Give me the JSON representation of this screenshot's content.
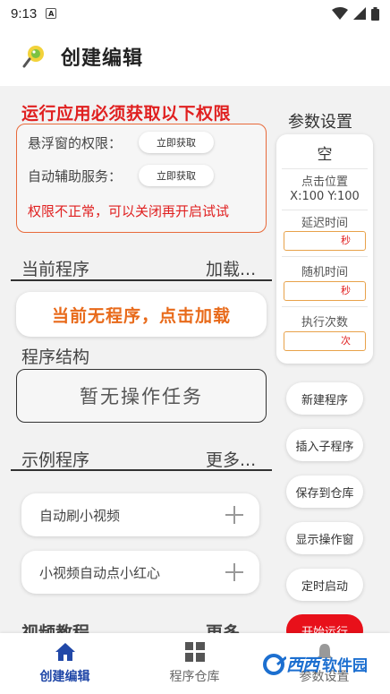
{
  "status_bar": {
    "time": "9:13",
    "notification_letter": "A"
  },
  "app_bar": {
    "title": "创建编辑"
  },
  "permissions": {
    "heading": "运行应用必须获取以下权限",
    "floating_label": "悬浮窗的权限：",
    "floating_button": "立即获取",
    "accessibility_label": "自动辅助服务：",
    "accessibility_button": "立即获取",
    "warning": "权限不正常，可以关闭再开启试试"
  },
  "current_program": {
    "title": "当前程序",
    "action": "加载...",
    "load_button": "当前无程序，点击加载"
  },
  "program_structure": {
    "title": "程序结构",
    "empty": "暂无操作任务"
  },
  "examples": {
    "title": "示例程序",
    "more": "更多...",
    "items": [
      {
        "label": "自动刷小视频"
      },
      {
        "label": "小视频自动点小红心"
      }
    ]
  },
  "tutorials": {
    "title": "视频教程",
    "more": "更多"
  },
  "params": {
    "title": "参数设置",
    "value": "空",
    "click_position_label": "点击位置",
    "click_position_value": "X:100  Y:100",
    "delay_label": "延迟时间",
    "delay_unit": "秒",
    "random_label": "随机时间",
    "random_unit": "秒",
    "count_label": "执行次数",
    "count_unit": "次"
  },
  "side_actions": {
    "new_program": "新建程序",
    "insert_subprogram": "插入子程序",
    "save_to_repo": "保存到仓库",
    "show_window": "显示操作窗",
    "timed_start": "定时启动",
    "start_run": "开始运行"
  },
  "bottom_nav": {
    "items": [
      {
        "label": "创建编辑",
        "active": true
      },
      {
        "label": "程序仓库",
        "active": false
      },
      {
        "label": "参数设置",
        "active": false
      }
    ]
  },
  "watermark": {
    "brand": "西西",
    "suffix": "软件园"
  },
  "colors": {
    "accent": "#2148a8",
    "warning_red": "#e02020",
    "orange": "#e86a1a",
    "run_red": "#e8101a"
  }
}
